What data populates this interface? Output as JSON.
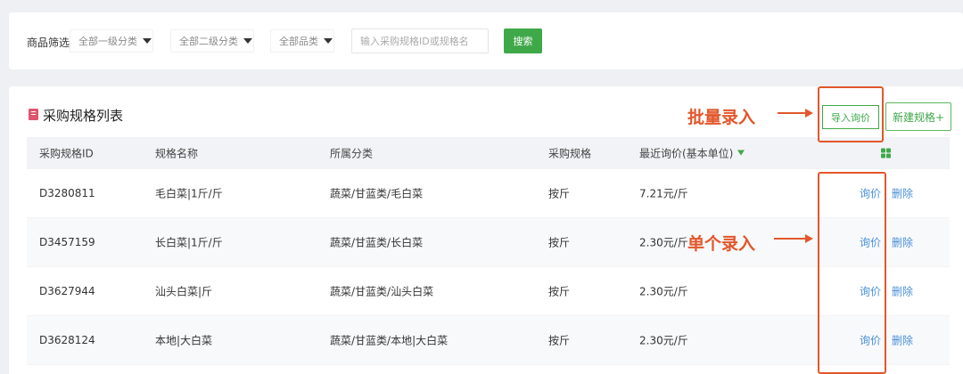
{
  "filter": {
    "label": "商品筛选",
    "dropdowns": [
      "全部一级分类",
      "全部二级分类",
      "全部品类"
    ],
    "search_placeholder": "输入采购规格ID或规格名",
    "search_button": "搜索"
  },
  "list": {
    "title": "采购规格列表",
    "import_button": "导入询价",
    "new_button": "新建规格+",
    "columns": [
      "采购规格ID",
      "规格名称",
      "所属分类",
      "采购规格",
      "最近询价(基本单位)"
    ],
    "rows": [
      {
        "id": "D3280811",
        "name": "毛白菜|1斤/斤",
        "category": "蔬菜/甘蓝类/毛白菜",
        "spec": "按斤",
        "price": "7.21元/斤",
        "ask": "询价",
        "delete": "删除"
      },
      {
        "id": "D3457159",
        "name": "长白菜|1斤/斤",
        "category": "蔬菜/甘蓝类/长白菜",
        "spec": "按斤",
        "price": "2.30元/斤",
        "ask": "询价",
        "delete": "删除"
      },
      {
        "id": "D3627944",
        "name": "汕头白菜|斤",
        "category": "蔬菜/甘蓝类/汕头白菜",
        "spec": "按斤",
        "price": "2.30元/斤",
        "ask": "询价",
        "delete": "删除"
      },
      {
        "id": "D3628124",
        "name": "本地|大白菜",
        "category": "蔬菜/甘蓝类/本地|大白菜",
        "spec": "按斤",
        "price": "2.30元/斤",
        "ask": "询价",
        "delete": "删除"
      }
    ]
  },
  "annotations": {
    "batch": "批量录入",
    "single": "单个录入"
  },
  "colors": {
    "accent_green": "#3fa849",
    "link_blue": "#4a90d9",
    "annotation_orange": "#e2572b",
    "title_icon_pink": "#e0566f"
  },
  "icons": [
    "caret-down-icon",
    "document-icon",
    "sort-caret-icon",
    "grid-settings-icon",
    "arrow-right-icon"
  ]
}
